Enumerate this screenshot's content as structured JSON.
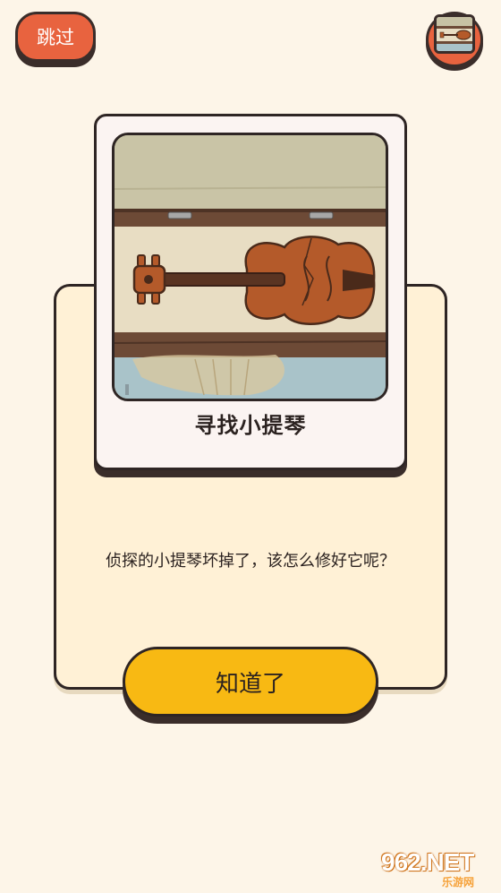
{
  "header": {
    "skip_label": "跳过",
    "thumbnail_icon": "violin-thumbnail-icon"
  },
  "card": {
    "title": "寻找小提琴",
    "image_icon": "violin-in-case-icon"
  },
  "dialog": {
    "message": "侦探的小提琴坏掉了，该怎么修好它呢？",
    "confirm_label": "知道了"
  },
  "watermark": {
    "brand": "962.NET",
    "subtitle": "乐游网"
  },
  "colors": {
    "background": "#fdf5e8",
    "skip_button": "#e8633f",
    "confirm_button": "#f8b913",
    "panel": "#fff1d6",
    "card": "#fbf4f2",
    "outline": "#2e2524"
  }
}
